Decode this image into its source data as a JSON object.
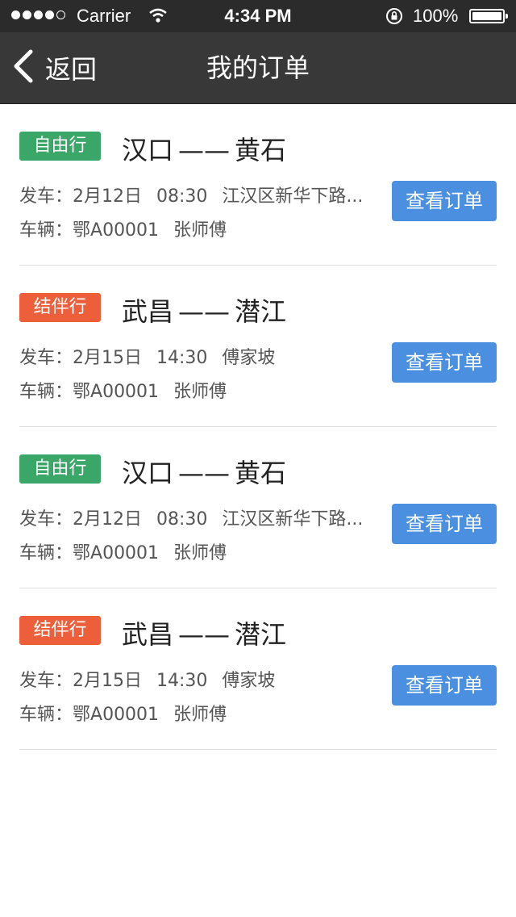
{
  "status_bar": {
    "carrier": "Carrier",
    "time": "4:34 PM",
    "battery": "100%"
  },
  "nav": {
    "back_label": "返回",
    "title": "我的订单"
  },
  "labels": {
    "depart_prefix": "发车：",
    "vehicle_prefix": "车辆：",
    "view_button": "查看订单"
  },
  "colors": {
    "free_tag": "#3aa667",
    "partner_tag": "#ec5f3a",
    "button": "#4a8fe0",
    "nav_bg": "#383838"
  },
  "orders": [
    {
      "tag": "自由行",
      "tag_color": "green",
      "from": "汉口",
      "to": "黄石",
      "date": "2月12日",
      "time": "08:30",
      "location": "江汉区新华下路...",
      "plate": "鄂A00001",
      "driver": "张师傅"
    },
    {
      "tag": "结伴行",
      "tag_color": "orange",
      "from": "武昌",
      "to": "潜江",
      "date": "2月15日",
      "time": "14:30",
      "location": "傅家坡",
      "plate": "鄂A00001",
      "driver": "张师傅"
    },
    {
      "tag": "自由行",
      "tag_color": "green",
      "from": "汉口",
      "to": "黄石",
      "date": "2月12日",
      "time": "08:30",
      "location": "江汉区新华下路...",
      "plate": "鄂A00001",
      "driver": "张师傅"
    },
    {
      "tag": "结伴行",
      "tag_color": "orange",
      "from": "武昌",
      "to": "潜江",
      "date": "2月15日",
      "time": "14:30",
      "location": "傅家坡",
      "plate": "鄂A00001",
      "driver": "张师傅"
    }
  ]
}
